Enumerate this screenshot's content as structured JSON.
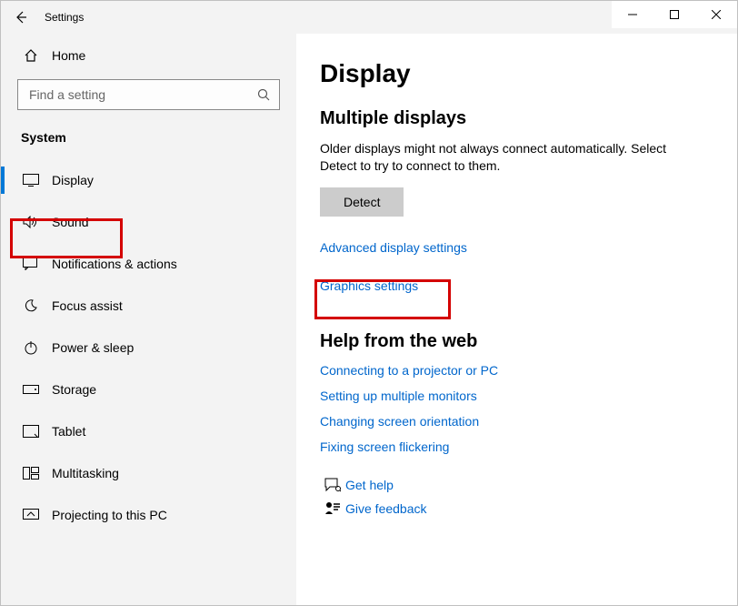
{
  "window": {
    "title": "Settings",
    "controls": {
      "minimize": "min",
      "maximize": "max",
      "close": "close"
    }
  },
  "sidebar": {
    "home_label": "Home",
    "search_placeholder": "Find a setting",
    "section_label": "System",
    "items": [
      {
        "id": "display",
        "icon": "monitor-icon",
        "label": "Display",
        "selected": true
      },
      {
        "id": "sound",
        "icon": "speaker-icon",
        "label": "Sound",
        "selected": false
      },
      {
        "id": "notifications",
        "icon": "message-icon",
        "label": "Notifications & actions",
        "selected": false
      },
      {
        "id": "focus-assist",
        "icon": "moon-icon",
        "label": "Focus assist",
        "selected": false
      },
      {
        "id": "power-sleep",
        "icon": "power-icon",
        "label": "Power & sleep",
        "selected": false
      },
      {
        "id": "storage",
        "icon": "drive-icon",
        "label": "Storage",
        "selected": false
      },
      {
        "id": "tablet",
        "icon": "tablet-icon",
        "label": "Tablet",
        "selected": false
      },
      {
        "id": "multitasking",
        "icon": "multitask-icon",
        "label": "Multitasking",
        "selected": false
      },
      {
        "id": "projecting",
        "icon": "projecting-icon",
        "label": "Projecting to this PC",
        "selected": false
      }
    ]
  },
  "main": {
    "page_title": "Display",
    "sections": {
      "multiple_displays": {
        "heading": "Multiple displays",
        "description": "Older displays might not always connect automatically. Select Detect to try to connect to them.",
        "button_label": "Detect",
        "links": [
          "Advanced display settings",
          "Graphics settings"
        ]
      },
      "help": {
        "heading": "Help from the web",
        "links": [
          "Connecting to a projector or PC",
          "Setting up multiple monitors",
          "Changing screen orientation",
          "Fixing screen flickering"
        ]
      },
      "feedback": {
        "get_help_label": "Get help",
        "give_feedback_label": "Give feedback"
      }
    }
  }
}
